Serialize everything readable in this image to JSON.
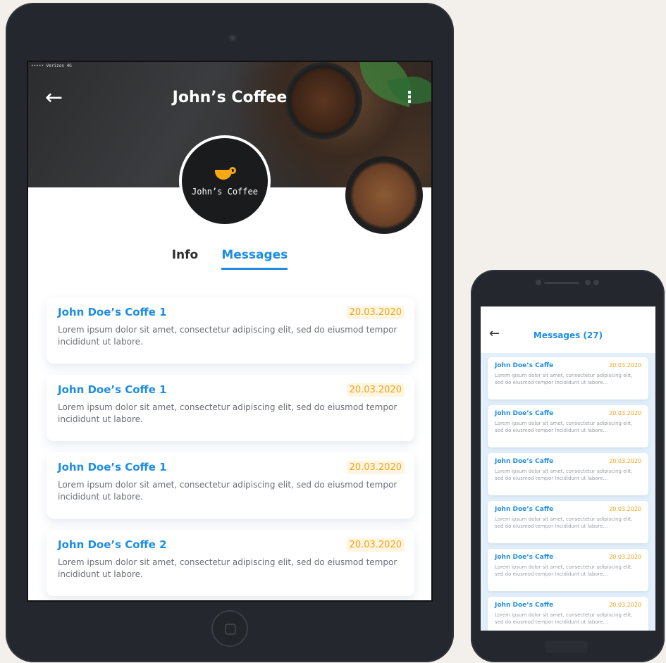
{
  "tablet": {
    "status_text": "••••• Verizon 4G",
    "back_icon": "arrow-left-icon",
    "title": "John’s Coffee",
    "menu_icon": "kebab-menu-icon",
    "avatar_name": "John’s Coffee",
    "tabs": [
      {
        "label": "Info",
        "active": false
      },
      {
        "label": "Messages",
        "active": true
      }
    ],
    "messages": [
      {
        "title": "John Doe’s Coffe 1",
        "date": "20.03.2020",
        "body": "Lorem ipsum dolor sit amet, consectetur adipiscing elit, sed do eiusmod tempor incididunt ut labore."
      },
      {
        "title": "John Doe’s Coffe 1",
        "date": "20.03.2020",
        "body": "Lorem ipsum dolor sit amet, consectetur adipiscing elit, sed do eiusmod tempor incididunt ut labore."
      },
      {
        "title": "John Doe’s Coffe 1",
        "date": "20.03.2020",
        "body": "Lorem ipsum dolor sit amet, consectetur adipiscing elit, sed do eiusmod tempor incididunt ut labore."
      },
      {
        "title": "John Doe’s Coffe 2",
        "date": "20.03.2020",
        "body": "Lorem ipsum dolor sit amet, consectetur adipiscing elit, sed do eiusmod tempor incididunt ut labore."
      }
    ]
  },
  "phone": {
    "back_icon": "arrow-left-icon",
    "title": "Messages (27)",
    "messages": [
      {
        "title": "John Doe’s Caffe",
        "date": "20.03.2020",
        "body": "Lorem ipsum dolor sit amet, consectetur adipiscing elit, sed do eiusmod tempor incididunt ut labore..."
      },
      {
        "title": "John Doe’s Caffe",
        "date": "20.03.2020",
        "body": "Lorem ipsum dolor sit amet, consectetur adipiscing elit, sed do eiusmod tempor incididunt ut labore..."
      },
      {
        "title": "John Doe’s Caffe",
        "date": "20.03.2020",
        "body": "Lorem ipsum dolor sit amet, consectetur adipiscing elit, sed do eiusmod tempor incididunt ut labore..."
      },
      {
        "title": "John Doe’s Caffe",
        "date": "20.03.2020",
        "body": "Lorem ipsum dolor sit amet, consectetur adipiscing elit, sed do eiusmod tempor incididunt ut labore..."
      },
      {
        "title": "John Doe’s Caffe",
        "date": "20.03.2020",
        "body": "Lorem ipsum dolor sit amet, consectetur adipiscing elit, sed do eiusmod tempor incididunt ut labore..."
      },
      {
        "title": "John Doe’s Caffe",
        "date": "20.03.2020",
        "body": "Lorem ipsum dolor sit amet, consectetur adipiscing elit, sed do eiusmod tempor incididunt ut labore..."
      }
    ]
  },
  "colors": {
    "accent": "#1f8de0",
    "date": "#f2a31c",
    "device": "#24272d",
    "background": "#f3f0eb"
  }
}
